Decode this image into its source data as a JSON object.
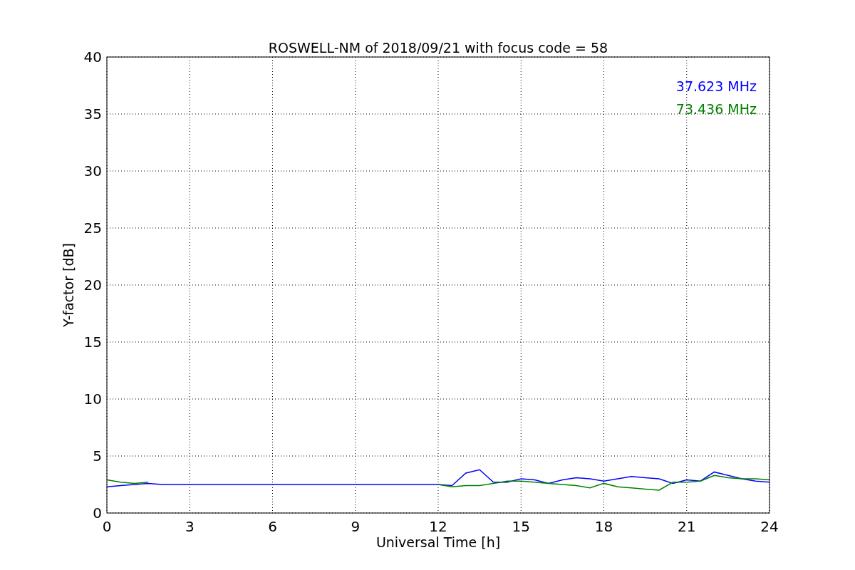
{
  "chart_data": {
    "type": "line",
    "title": "ROSWELL-NM of 2018/09/21 with focus code = 58",
    "xlabel": "Universal Time [h]",
    "ylabel": "Y-factor [dB]",
    "x": [
      0,
      0.5,
      1,
      1.5,
      2,
      2.5,
      3,
      3.5,
      4,
      4.5,
      5,
      5.5,
      6,
      6.5,
      7,
      7.5,
      8,
      8.5,
      9,
      9.5,
      10,
      10.5,
      11,
      11.5,
      12,
      12.5,
      13,
      13.5,
      14,
      14.5,
      15,
      15.5,
      16,
      16.5,
      17,
      17.5,
      18,
      18.5,
      19,
      19.5,
      20,
      20.5,
      21,
      21.5,
      22,
      22.5,
      23,
      23.5,
      24
    ],
    "series": [
      {
        "name": "37.623 MHz",
        "color": "#0000ff",
        "values": [
          2.3,
          2.4,
          2.5,
          2.6,
          2.5,
          2.5,
          2.5,
          2.5,
          2.5,
          2.5,
          2.5,
          2.5,
          2.5,
          2.5,
          2.5,
          2.5,
          2.5,
          2.5,
          2.5,
          2.5,
          2.5,
          2.5,
          2.5,
          2.5,
          2.5,
          2.4,
          3.5,
          3.8,
          2.7,
          2.7,
          3.0,
          2.9,
          2.6,
          2.9,
          3.1,
          3.0,
          2.8,
          3.0,
          3.2,
          3.1,
          3.0,
          2.6,
          2.9,
          2.8,
          3.6,
          3.3,
          3.0,
          2.8,
          2.7
        ]
      },
      {
        "name": "73.436 MHz",
        "color": "#008000",
        "values": [
          2.9,
          2.7,
          2.6,
          2.7,
          null,
          null,
          null,
          null,
          null,
          null,
          null,
          null,
          null,
          null,
          null,
          null,
          null,
          null,
          null,
          null,
          null,
          null,
          null,
          null,
          2.5,
          2.3,
          2.4,
          2.4,
          2.6,
          2.8,
          2.8,
          2.7,
          2.6,
          2.5,
          2.4,
          2.2,
          2.6,
          2.3,
          2.2,
          2.1,
          2.0,
          2.7,
          2.7,
          2.8,
          3.3,
          3.1,
          3.0,
          3.0,
          2.9
        ]
      }
    ],
    "grid": true,
    "xlim": [
      0,
      24
    ],
    "ylim": [
      0,
      40
    ],
    "xticks": [
      0,
      3,
      6,
      9,
      12,
      15,
      18,
      21,
      24
    ],
    "yticks": [
      0,
      5,
      10,
      15,
      20,
      25,
      30,
      35,
      40
    ]
  }
}
